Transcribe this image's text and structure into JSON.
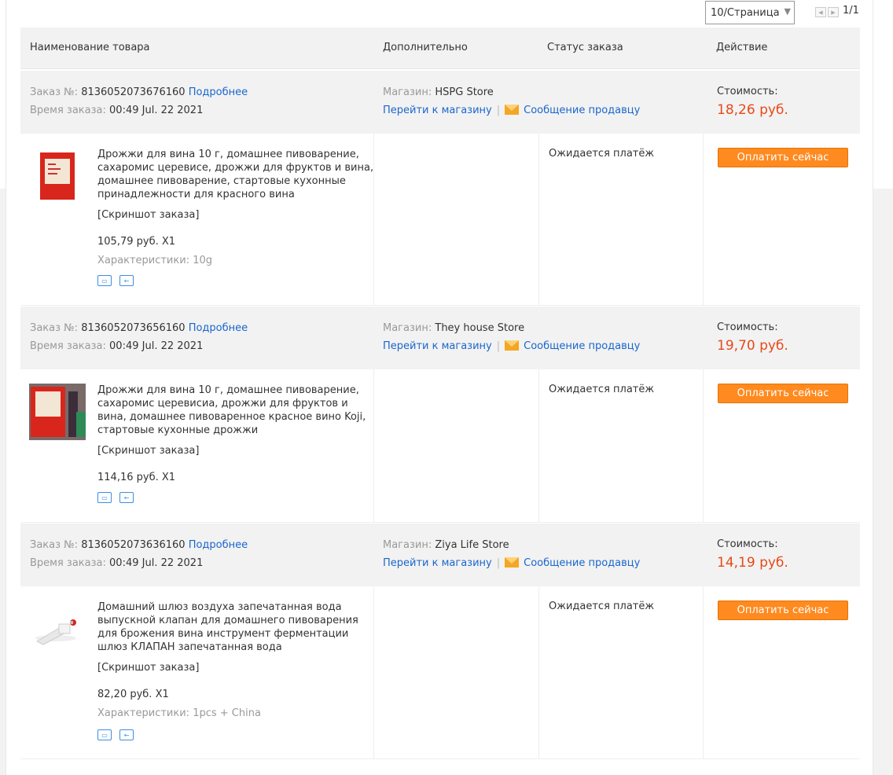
{
  "pager": {
    "per_page": "10/Страница",
    "page": "1/1"
  },
  "columns": {
    "product": "Наименование товара",
    "extra": "Дополнительно",
    "status": "Статус заказа",
    "action": "Действие"
  },
  "labels": {
    "order_no": "Заказ №:",
    "details": "Подробнее",
    "order_time": "Время заказа:",
    "store": "Магазин:",
    "go_store": "Перейти к магазину",
    "message": "Сообщение продавцу",
    "cost": "Стоимость:",
    "snapshot": "[Скриншот заказа]",
    "pay_now": "Оплатить сейчас",
    "status_waiting": "Ожидается платёж"
  },
  "orders": [
    {
      "number": "8136052073676160",
      "time": "00:49 Jul. 22 2021",
      "store": "HSPG Store",
      "cost": "18,26 руб.",
      "product": "Дрожжи для вина 10 г, домашнее пивоварение, сахаромис церевисе, дрожжи для фруктов и вина, домашнее пивоварение, стартовые кухонные принадлежности для красного вина",
      "qty": "105,79 руб. X1",
      "spec": "Характеристики: 10g",
      "status": "Ожидается платёж"
    },
    {
      "number": "8136052073656160",
      "time": "00:49 Jul. 22 2021",
      "store": "They house Store",
      "cost": "19,70 руб.",
      "product": "Дрожжи для вина 10 г, домашнее пивоварение, сахаромис церевисиа, дрожжи для фруктов и вина, домашнее пивоваренное красное вино Koji, стартовые кухонные дрожжи",
      "qty": "114,16 руб. X1",
      "spec": "",
      "status": "Ожидается платёж"
    },
    {
      "number": "8136052073636160",
      "time": "00:49 Jul. 22 2021",
      "store": "Ziya Life Store",
      "cost": "14,19 руб.",
      "product": "Домашний шлюз воздуха запечатанная вода выпускной клапан для домашнего пивоварения для брожения вина инструмент ферментации шлюз КЛАПАН запечатанная вода",
      "qty": "82,20 руб. X1",
      "spec": "Характеристики: 1pcs + China",
      "status": "Ожидается платёж"
    }
  ]
}
